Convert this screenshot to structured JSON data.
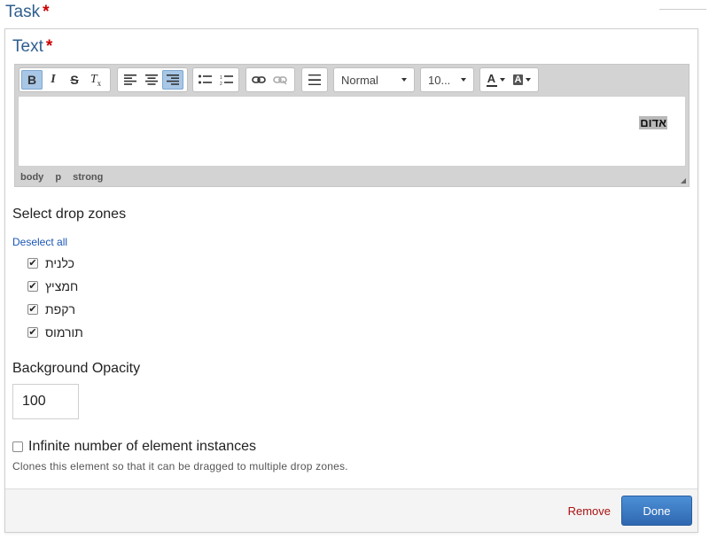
{
  "header": {
    "title": "Task",
    "required_mark": "*"
  },
  "text_field": {
    "label": "Text",
    "required_mark": "*"
  },
  "toolbar": {
    "bold": "B",
    "italic": "I",
    "strike": "S",
    "clear_format": "Tx",
    "format_select": "Normal",
    "size_select": "10...",
    "text_color": "A",
    "bg_color": "A"
  },
  "editor": {
    "content": "אדום",
    "path": [
      "body",
      "p",
      "strong"
    ]
  },
  "drop_zones": {
    "title": "Select drop zones",
    "deselect_all": "Deselect all",
    "items": [
      {
        "label": "כלנית",
        "checked": true
      },
      {
        "label": "חמציץ",
        "checked": true
      },
      {
        "label": "רקפת",
        "checked": true
      },
      {
        "label": "תורמוס",
        "checked": true
      }
    ]
  },
  "opacity": {
    "label": "Background Opacity",
    "value": "100"
  },
  "infinite": {
    "label": "Infinite number of element instances",
    "checked": false,
    "description": "Clones this element so that it can be dragged to multiple drop zones."
  },
  "footer": {
    "remove": "Remove",
    "done": "Done"
  },
  "colors": {
    "title": "#2f5f8f",
    "required": "#cc0000",
    "primary": "#3a78c2",
    "remove": "#aa1111",
    "link": "#1a56b5"
  }
}
